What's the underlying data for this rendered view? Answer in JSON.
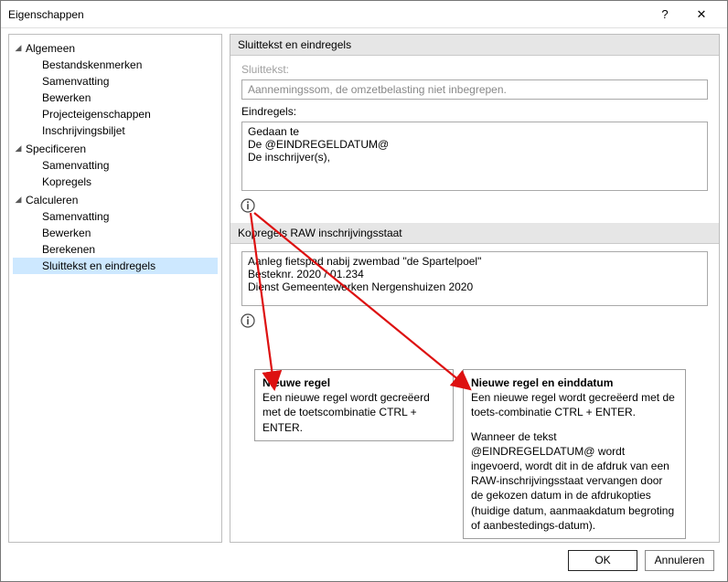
{
  "title": "Eigenschappen",
  "titlebar": {
    "help": "?",
    "close": "✕"
  },
  "sidebar": {
    "groups": [
      {
        "label": "Algemeen",
        "items": [
          "Bestandskenmerken",
          "Samenvatting",
          "Bewerken",
          "Projecteigenschappen",
          "Inschrijvingsbiljet"
        ]
      },
      {
        "label": "Specificeren",
        "items": [
          "Samenvatting",
          "Kopregels"
        ]
      },
      {
        "label": "Calculeren",
        "items": [
          "Samenvatting",
          "Bewerken",
          "Berekenen",
          "Sluittekst en eindregels"
        ]
      }
    ],
    "selected": "Sluittekst en eindregels"
  },
  "section1": {
    "header": "Sluittekst en eindregels",
    "sluittekst_label": "Sluittekst:",
    "sluittekst_value": "Aannemingssom, de omzetbelasting niet inbegrepen.",
    "eindregels_label": "Eindregels:",
    "eindregels_value": "Gedaan te\nDe @EINDREGELDATUM@\nDe inschrijver(s),"
  },
  "section2": {
    "header": "Kopregels RAW inschrijvingsstaat",
    "value": "Aanleg fietspad nabij zwembad \"de Spartelpoel\"\nBesteknr. 2020 / 01.234\nDienst Gemeentewerken Nergenshuizen 2020"
  },
  "tip1": {
    "title": "Nieuwe regel",
    "text": "Een nieuwe regel wordt gecreëerd met de toetscombinatie CTRL + ENTER."
  },
  "tip2": {
    "title": "Nieuwe regel en einddatum",
    "p1": "Een nieuwe regel wordt gecreëerd met de toets-combinatie CTRL + ENTER.",
    "p2": "Wanneer de tekst @EINDREGELDATUM@ wordt ingevoerd, wordt dit in de afdruk van een RAW-inschrijvingsstaat vervangen door de gekozen datum in de afdrukopties (huidige datum, aanmaakdatum begroting of aanbestedings-datum)."
  },
  "buttons": {
    "ok": "OK",
    "cancel": "Annuleren"
  }
}
